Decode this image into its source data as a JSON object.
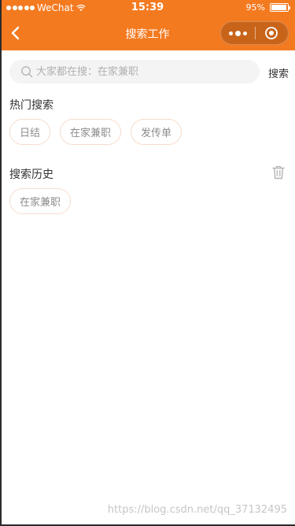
{
  "status_bar": {
    "carrier": "WeChat",
    "time": "15:39",
    "battery": "95%",
    "battery_level": 0.95
  },
  "nav": {
    "title": "搜索工作"
  },
  "search": {
    "placeholder": "大家都在搜：在家兼职",
    "value": "",
    "button_label": "搜索"
  },
  "hot_search": {
    "title": "热门搜索",
    "tags": [
      "日结",
      "在家兼职",
      "发传单"
    ]
  },
  "history": {
    "title": "搜索历史",
    "tags": [
      "在家兼职"
    ]
  },
  "watermark": "https://blog.csdn.net/qq_37132495",
  "colors": {
    "brand": "#F47A20",
    "tag_border": "#f6dccb",
    "tag_text": "#8c8c8c"
  },
  "icons": [
    "back-arrow-icon",
    "more-dots-icon",
    "close-target-icon",
    "search-icon",
    "trash-icon",
    "wifi-icon",
    "battery-icon"
  ]
}
